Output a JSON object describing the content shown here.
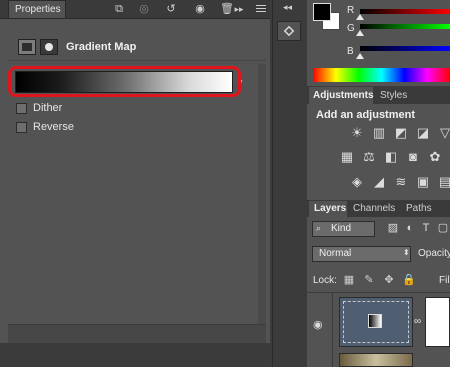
{
  "properties": {
    "tab_label": "Properties",
    "collapse_icon": "double-chevron-right-icon",
    "menu_icon": "panel-menu-icon",
    "title": "Gradient Map",
    "gradient_stops": [
      "#000000",
      "#ffffff"
    ],
    "highlight_color": "#e0141a",
    "dither_label": "Dither",
    "dither_checked": false,
    "reverse_label": "Reverse",
    "reverse_checked": false,
    "bottom_icons": [
      "clip-to-layer-icon",
      "view-previous-state-icon",
      "reset-icon",
      "visibility-eye-icon",
      "trash-icon"
    ]
  },
  "color": {
    "foreground": "#000000",
    "background": "#ffffff",
    "r_label": "R",
    "g_label": "G",
    "b_label": "B"
  },
  "adjustments": {
    "tab_label": "Adjustments",
    "styles_tab_label": "Styles",
    "heading": "Add an adjustment",
    "icons": [
      "brightness-contrast-icon",
      "levels-icon",
      "curves-icon",
      "exposure-icon",
      "vibrance-icon",
      "hue-saturation-icon",
      "color-balance-icon",
      "black-white-icon",
      "photo-filter-icon",
      "channel-mixer-icon",
      "color-lookup-icon",
      "invert-icon",
      "posterize-icon",
      "threshold-icon",
      "gradient-map-icon",
      "selective-color-icon"
    ]
  },
  "layers": {
    "tab_label": "Layers",
    "channels_tab_label": "Channels",
    "paths_tab_label": "Paths",
    "kind_label": "Kind",
    "blend_mode": "Normal",
    "opacity_label": "Opacity",
    "lock_label": "Lock:",
    "fill_label": "Fill"
  }
}
